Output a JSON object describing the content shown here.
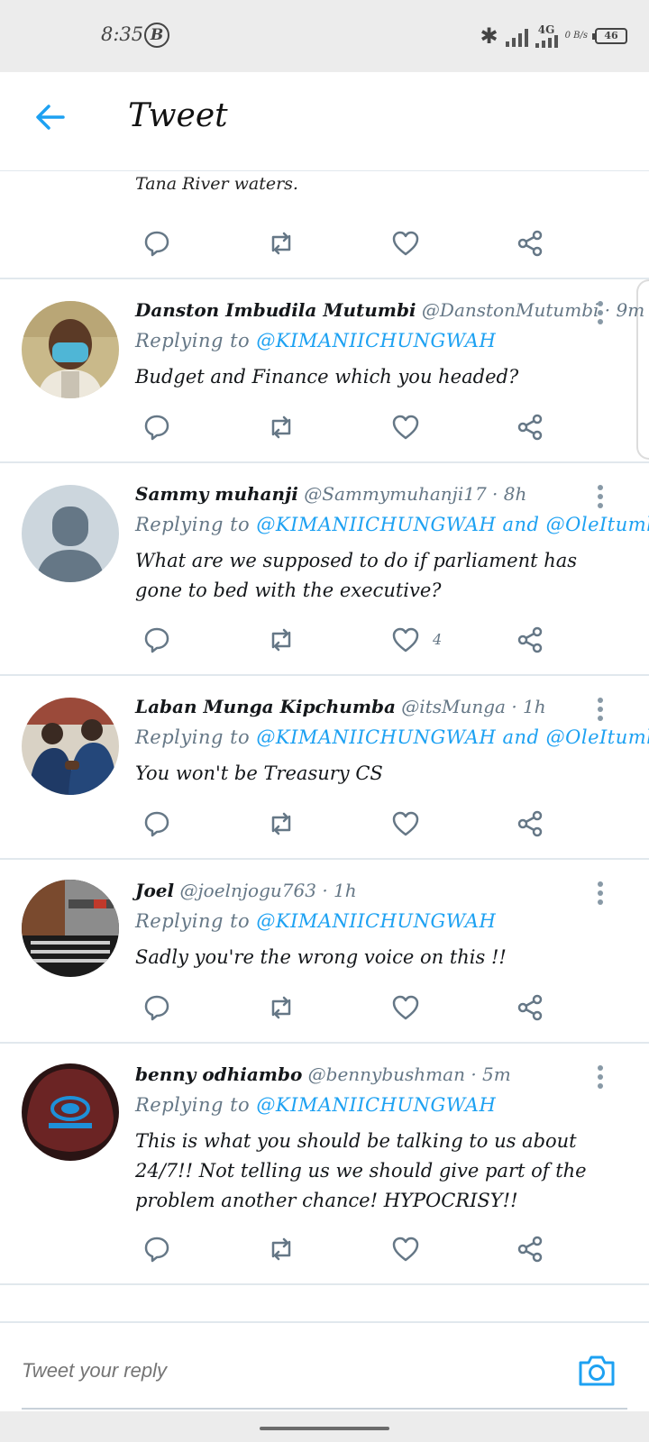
{
  "status_bar": {
    "time": "8:35",
    "b_badge": "B",
    "network": "4G",
    "speed": "0 B/s",
    "battery": "46"
  },
  "header": {
    "title": "Tweet"
  },
  "top_cut_tweet": {
    "text_last_line": "Tana River waters."
  },
  "tweets": [
    {
      "name": "Danston Imbudila Mutumbi",
      "handle": "@DanstonMutumbi",
      "time": "· 9m",
      "replying_prefix": "Replying to",
      "replying_to": "@KIMANIICHUNGWAH",
      "replying_to_2": "",
      "text": "Budget and Finance which you headed?",
      "likes": ""
    },
    {
      "name": "Sammy muhanji",
      "handle": "@Sammymuhanji17",
      "time": "· 8h",
      "replying_prefix": "Replying to",
      "replying_to": "@KIMANIICHUNGWAH",
      "replying_and": "and",
      "replying_to_2": "@OleItumbi",
      "text": "What are we supposed to do if parliament has gone to bed with the executive?",
      "likes": "4"
    },
    {
      "name": "Laban Munga Kipchumba",
      "handle": "@itsMunga",
      "time": "· 1h",
      "replying_prefix": "Replying to",
      "replying_to": "@KIMANIICHUNGWAH",
      "replying_and": "and",
      "replying_to_2": "@OleItumbi",
      "text": "You won't be Treasury CS",
      "likes": ""
    },
    {
      "name": "Joel",
      "handle": "@joelnjogu763",
      "time": "· 1h",
      "replying_prefix": "Replying to",
      "replying_to": "@KIMANIICHUNGWAH",
      "replying_to_2": "",
      "text": "Sadly you're the wrong voice on this !!",
      "likes": ""
    },
    {
      "name": "benny odhiambo",
      "handle": "@bennybushman",
      "time": "· 5m",
      "replying_prefix": "Replying to",
      "replying_to": "@KIMANIICHUNGWAH",
      "replying_to_2": "",
      "text": "This is what you should be talking to us about 24/7!! Not telling us we should give part of the problem another chance! HYPOCRISY!!",
      "likes": ""
    }
  ],
  "compose": {
    "placeholder": "Tweet your reply"
  },
  "colors": {
    "accent": "#1da1f2",
    "muted": "#657786",
    "divider": "#e1e8ed"
  }
}
